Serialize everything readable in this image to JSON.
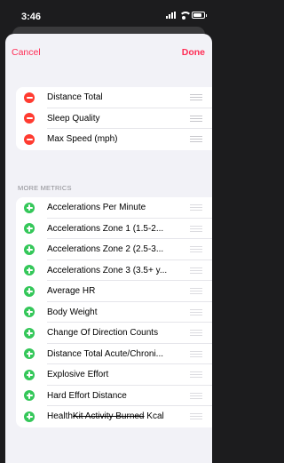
{
  "status": {
    "time": "3:46"
  },
  "nav": {
    "cancel_label": "Cancel",
    "done_label": "Done"
  },
  "selected_metrics": [
    {
      "label": "Distance Total"
    },
    {
      "label": "Sleep Quality"
    },
    {
      "label": "Max Speed (mph)"
    }
  ],
  "more_metrics": {
    "header": "MORE METRICS",
    "items": [
      {
        "label": "Accelerations Per Minute"
      },
      {
        "label": "Accelerations Zone 1 (1.5-2..."
      },
      {
        "label": "Accelerations Zone 2 (2.5-3..."
      },
      {
        "label": "Accelerations Zone 3 (3.5+ y..."
      },
      {
        "label": "Average HR"
      },
      {
        "label": "Body Weight"
      },
      {
        "label": "Change Of Direction Counts"
      },
      {
        "label": "Distance Total Acute/Chroni..."
      },
      {
        "label": "Explosive Effort"
      },
      {
        "label": "Hard Effort Distance"
      },
      {
        "label_prefix": "Health",
        "label_struck": "Kit Activity Burned",
        "label_suffix": " Kcal"
      }
    ]
  },
  "colors": {
    "accent": "#ff2d55",
    "remove": "#ff3b30",
    "add": "#34c759"
  }
}
